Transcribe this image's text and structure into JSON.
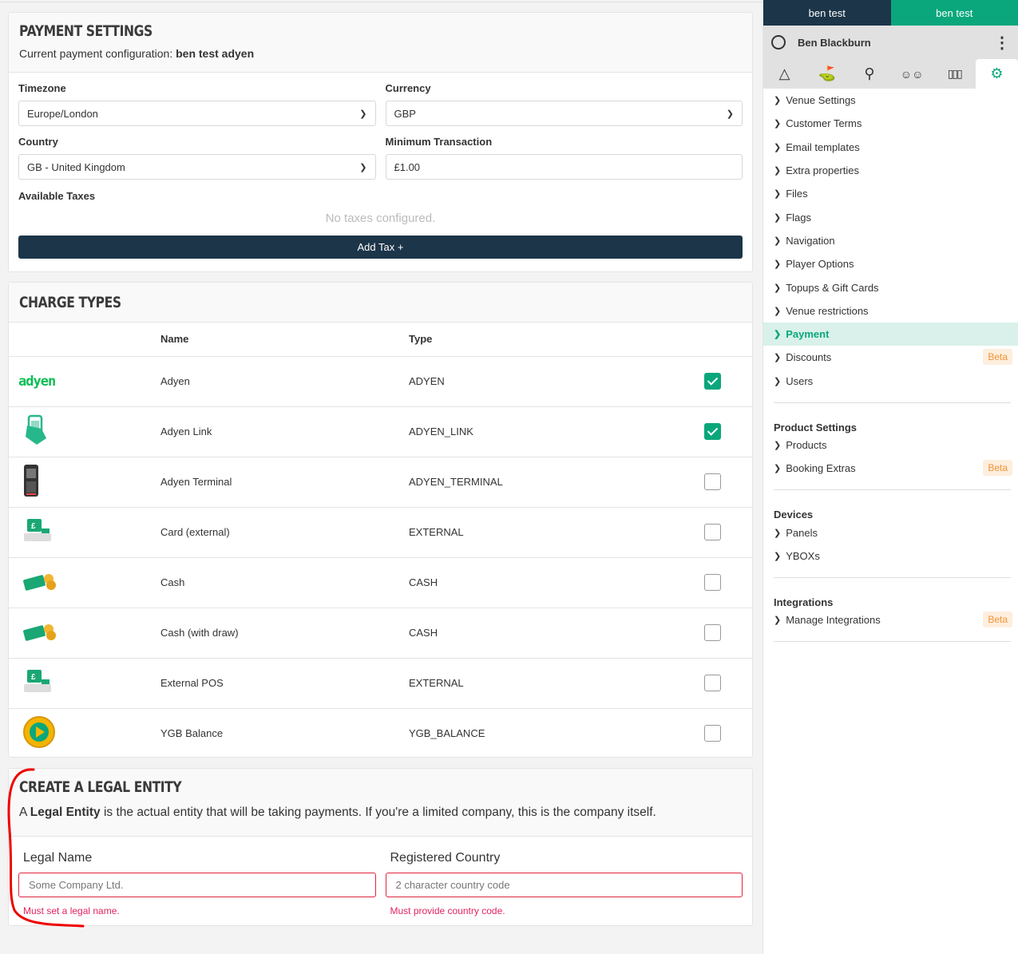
{
  "payment_settings": {
    "title": "PAYMENT SETTINGS",
    "config_label": "Current payment configuration:",
    "config_value": "ben test adyen",
    "timezone_label": "Timezone",
    "timezone_value": "Europe/London",
    "currency_label": "Currency",
    "currency_value": "GBP",
    "country_label": "Country",
    "country_value": "GB - United Kingdom",
    "min_label": "Minimum Transaction",
    "min_value": "£1.00",
    "taxes_label": "Available Taxes",
    "taxes_empty": "No taxes configured.",
    "add_tax": "Add Tax +"
  },
  "charge_types": {
    "title": "CHARGE TYPES",
    "col_name": "Name",
    "col_type": "Type",
    "rows": [
      {
        "icon": "adyen-logo",
        "name": "Adyen",
        "type": "ADYEN",
        "checked": true
      },
      {
        "icon": "phone-qr-icon",
        "name": "Adyen Link",
        "type": "ADYEN_LINK",
        "checked": true
      },
      {
        "icon": "card-terminal-icon",
        "name": "Adyen Terminal",
        "type": "ADYEN_TERMINAL",
        "checked": false
      },
      {
        "icon": "pos-till-icon",
        "name": "Card (external)",
        "type": "EXTERNAL",
        "checked": false
      },
      {
        "icon": "cash-coins-icon",
        "name": "Cash",
        "type": "CASH",
        "checked": false
      },
      {
        "icon": "cash-coins-icon",
        "name": "Cash (with draw)",
        "type": "CASH",
        "checked": false
      },
      {
        "icon": "pos-till-icon",
        "name": "External POS",
        "type": "EXTERNAL",
        "checked": false
      },
      {
        "icon": "ygb-coin-icon",
        "name": "YGB Balance",
        "type": "YGB_BALANCE",
        "checked": false
      }
    ],
    "adyen_logo_text": "adyen"
  },
  "legal_entity": {
    "title": "CREATE A LEGAL ENTITY",
    "desc_pre": "A ",
    "desc_bold": "Legal Entity",
    "desc_post": " is the actual entity that will be taking payments. If you're a limited company, this is the company itself.",
    "name_label": "Legal Name",
    "name_placeholder": "Some Company Ltd.",
    "name_error": "Must set a legal name.",
    "country_label": "Registered Country",
    "country_placeholder": "2 character country code",
    "country_error": "Must provide country code."
  },
  "sidebar": {
    "tab1": "ben test",
    "tab2": "ben test",
    "user": "Ben Blackburn",
    "icons": [
      "tee-area-icon",
      "golf-flag-icon",
      "search-icon",
      "users-icon",
      "bar-chart-icon",
      "settings-icon"
    ],
    "items": [
      {
        "label": "Venue Settings"
      },
      {
        "label": "Customer Terms"
      },
      {
        "label": "Email templates"
      },
      {
        "label": "Extra properties"
      },
      {
        "label": "Files"
      },
      {
        "label": "Flags"
      },
      {
        "label": "Navigation"
      },
      {
        "label": "Player Options"
      },
      {
        "label": "Topups & Gift Cards"
      },
      {
        "label": "Venue restrictions"
      },
      {
        "label": "Payment",
        "active": true
      },
      {
        "label": "Discounts",
        "badge": "Beta"
      },
      {
        "label": "Users"
      }
    ],
    "sections": [
      {
        "title": "Product Settings",
        "items": [
          {
            "label": "Products"
          },
          {
            "label": "Booking Extras",
            "badge": "Beta"
          }
        ]
      },
      {
        "title": "Devices",
        "items": [
          {
            "label": "Panels"
          },
          {
            "label": "YBOXs"
          }
        ]
      },
      {
        "title": "Integrations",
        "items": [
          {
            "label": "Manage Integrations",
            "badge": "Beta"
          }
        ]
      }
    ]
  },
  "colors": {
    "primary": "#1c3549",
    "accent": "#0aa77c",
    "error": "#e0243c",
    "beta": "#f19336"
  }
}
